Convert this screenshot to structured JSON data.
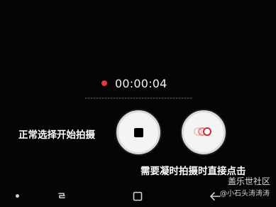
{
  "recording": {
    "elapsed": "00:00:04",
    "indicator_color": "#e0383e"
  },
  "controls": {
    "stop_icon": "stop-square-icon",
    "capture_icon": "burst-capture-icon"
  },
  "captions": {
    "normal_capture": "正常选择开始拍摄",
    "pause_capture": "需要凝时拍摄时直接点击"
  },
  "watermark": {
    "site": "盖乐世社区",
    "author": "@小石头涛涛涛"
  },
  "navigation": {
    "icons": [
      "dot-icon",
      "recents-icon",
      "home-icon",
      "back-icon"
    ]
  }
}
